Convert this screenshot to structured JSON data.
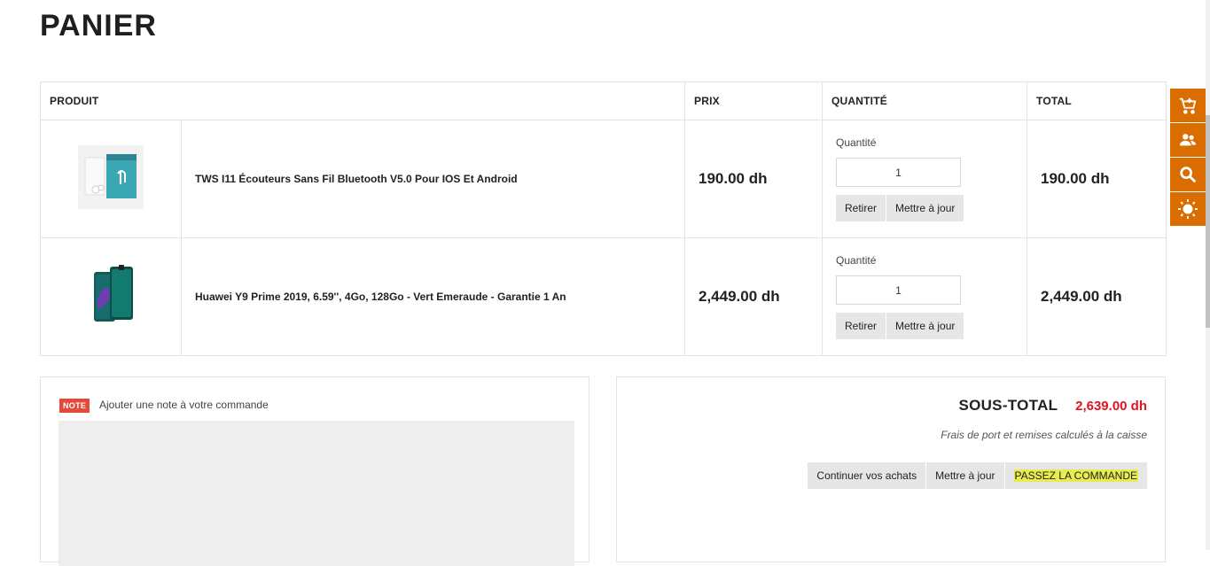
{
  "page": {
    "title": "PANIER"
  },
  "table": {
    "headers": {
      "product": "PRODUIT",
      "price": "PRIX",
      "quantity": "QUANTITÉ",
      "total": "TOTAL"
    },
    "rows": [
      {
        "name": "TWS I11 Écouteurs Sans Fil Bluetooth V5.0 Pour IOS Et Android",
        "price": "190.00 dh",
        "qty_label": "Quantité",
        "qty_value": "1",
        "remove_label": "Retirer",
        "update_label": "Mettre à jour",
        "total": "190.00 dh",
        "image_icon": "earbuds-box-image"
      },
      {
        "name": "Huawei Y9 Prime 2019, 6.59'', 4Go, 128Go - Vert Emeraude - Garantie 1 An",
        "price": "2,449.00 dh",
        "qty_label": "Quantité",
        "qty_value": "1",
        "remove_label": "Retirer",
        "update_label": "Mettre à jour",
        "total": "2,449.00 dh",
        "image_icon": "smartphone-image"
      }
    ]
  },
  "note": {
    "badge": "NOTE",
    "label": "Ajouter une note à votre commande"
  },
  "summary": {
    "subtotal_label": "SOUS-TOTAL",
    "subtotal_value": "2,639.00 dh",
    "shipping_note": "Frais de port et remises calculés à la caisse",
    "continue_label": "Continuer vos achats",
    "update_label": "Mettre à jour",
    "checkout_label": "PASSEZ LA COMMANDE"
  },
  "toolbar": {
    "icons": [
      "cart-icon",
      "users-icon",
      "search-icon",
      "sun-icon"
    ]
  },
  "colors": {
    "accent": "#d96d00",
    "price_red": "#e0141e",
    "highlight": "#e7ec4f",
    "note_badge": "#e24b3b"
  }
}
